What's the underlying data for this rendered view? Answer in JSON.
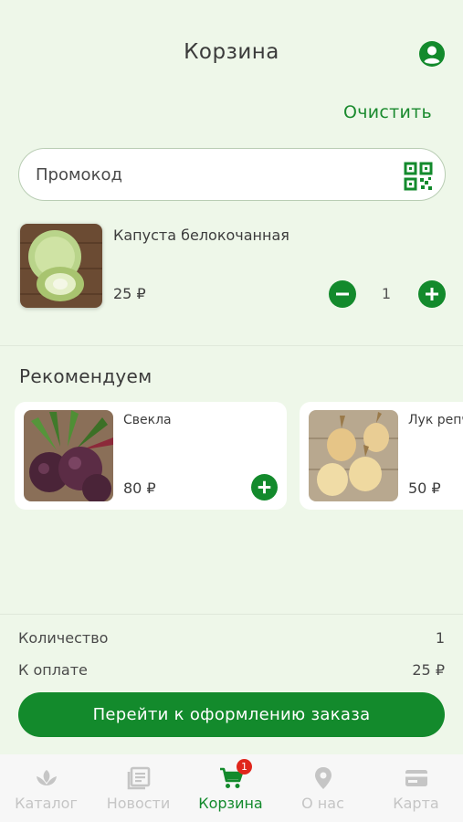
{
  "header": {
    "title": "Корзина",
    "clear_label": "Очистить"
  },
  "promo": {
    "placeholder": "Промокод",
    "value": ""
  },
  "cart": {
    "items": [
      {
        "name": "Капуста белокочанная",
        "price": "25 ₽",
        "quantity": "1"
      }
    ]
  },
  "recommendations": {
    "title": "Рекомендуем",
    "items": [
      {
        "name": "Свекла",
        "price": "80 ₽"
      },
      {
        "name": "Лук репчатый",
        "price": "50 ₽"
      }
    ]
  },
  "summary": {
    "quantity_label": "Количество",
    "quantity_value": "1",
    "total_label": "К оплате",
    "total_value": "25 ₽"
  },
  "checkout_label": "Перейти к оформлению заказа",
  "tabs": [
    {
      "label": "Каталог",
      "icon": "catalog-leaf-icon"
    },
    {
      "label": "Новости",
      "icon": "news-icon"
    },
    {
      "label": "Корзина",
      "icon": "cart-icon",
      "badge": "1",
      "active": true
    },
    {
      "label": "О нас",
      "icon": "map-pin-icon"
    },
    {
      "label": "Карта",
      "icon": "card-icon"
    }
  ],
  "colors": {
    "accent": "#138a2c",
    "background": "#eef7e9",
    "badge": "#e0261c",
    "inactive": "#c5c5c5"
  }
}
